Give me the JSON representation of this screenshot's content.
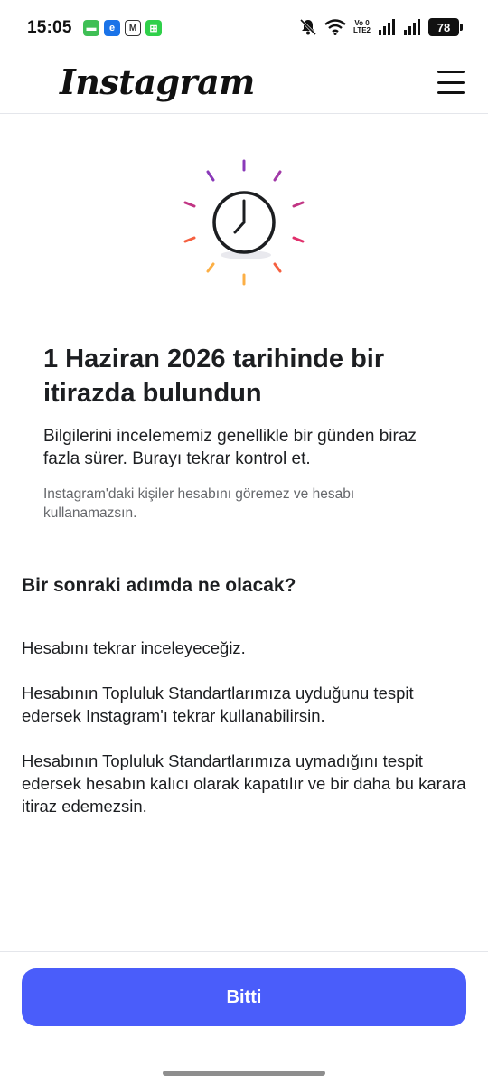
{
  "status_bar": {
    "time": "15:05",
    "battery": "78",
    "volte_top": "Vo 0",
    "volte_bottom": "LTE2"
  },
  "header": {
    "logo": "Instagram",
    "menu_icon": "hamburger-menu-icon"
  },
  "illustration": {
    "icon": "clock-icon",
    "ray_colors": [
      "#8a3ab9",
      "#c13584",
      "#e1306c",
      "#fd1d1d",
      "#f56040",
      "#fcaf45",
      "#e8a317"
    ]
  },
  "main": {
    "title": "1 Haziran 2026 tarihinde bir itirazda bulundun",
    "subtitle": "Bilgilerini incelememiz genellikle bir günden biraz fazla sürer. Burayı tekrar kontrol et.",
    "note": "Instagram'daki kişiler hesabını göremez ve hesabı kullanamazsın."
  },
  "next_steps": {
    "heading": "Bir sonraki adımda ne olacak?",
    "items": [
      "Hesabını tekrar inceleyeceğiz.",
      "Hesabının Topluluk Standartlarımıza uyduğunu tespit edersek Instagram'ı tekrar kullanabilirsin.",
      "Hesabının Topluluk Standartlarımıza uymadığını tespit edersek hesabın kalıcı olarak kapatılır ve bir daha bu karara itiraz edemezsin."
    ]
  },
  "footer": {
    "done_label": "Bitti",
    "accent": "#4a5dfa"
  }
}
